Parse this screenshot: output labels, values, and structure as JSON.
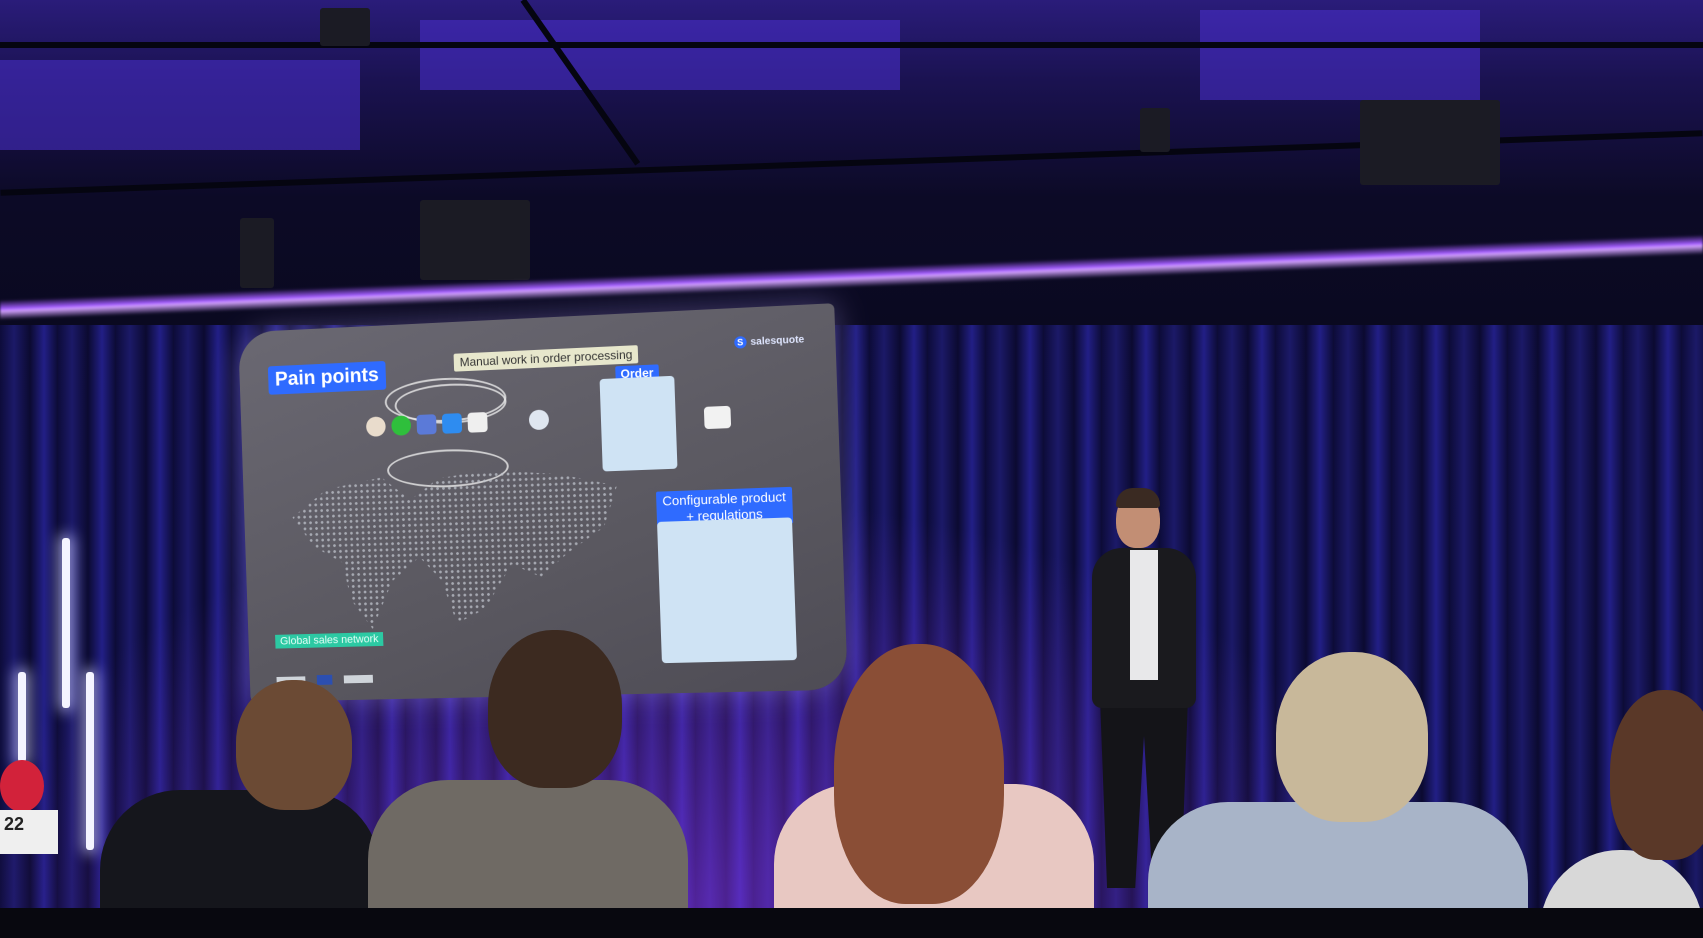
{
  "photo": {
    "subject": "conference-talk",
    "accent_colors": {
      "stage_purple": "#7a3cff",
      "slide_blue": "#2f6bff",
      "slide_teal": "#2cc9a3"
    }
  },
  "slide": {
    "title": "Pain points",
    "brand": "salesquote",
    "brand_letter": "S",
    "manual_label": "Manual work in order processing",
    "order_label": "Order",
    "config_label_line1": "Configurable product",
    "config_label_line2": "+ regulations",
    "global_label": "Global sales network"
  },
  "stand_number": "22"
}
